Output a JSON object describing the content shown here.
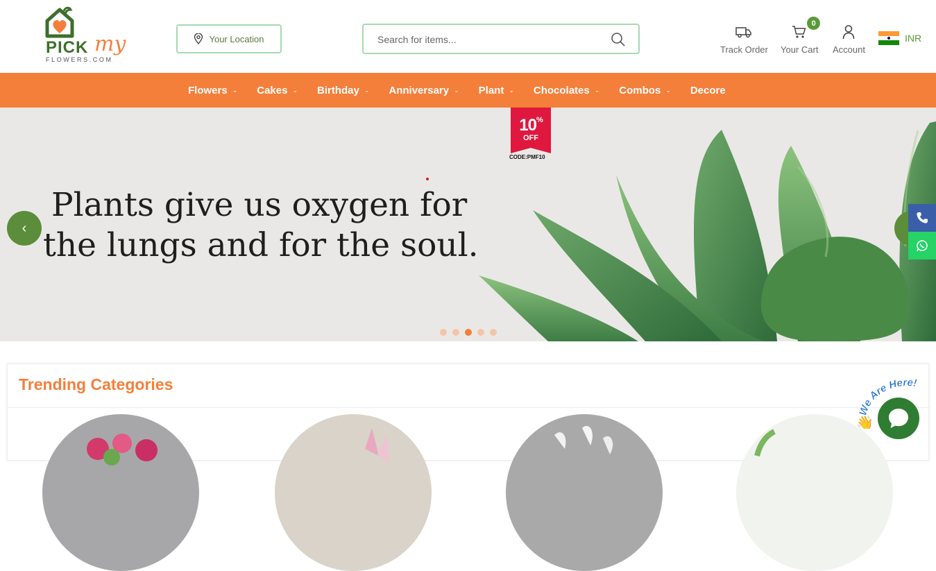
{
  "brand": {
    "logo_main": "PICK",
    "logo_accent": "my",
    "logo_sub": "FLOWERS.COM"
  },
  "header": {
    "location_label": "Your Location",
    "search_placeholder": "Search for items...",
    "track_order": "Track Order",
    "cart": "Your Cart",
    "cart_count": "0",
    "account": "Account",
    "currency": "INR"
  },
  "nav": {
    "items": [
      {
        "label": "Flowers",
        "dropdown": true
      },
      {
        "label": "Cakes",
        "dropdown": true
      },
      {
        "label": "Birthday",
        "dropdown": true
      },
      {
        "label": "Anniversary",
        "dropdown": true
      },
      {
        "label": "Plant",
        "dropdown": true
      },
      {
        "label": "Chocolates",
        "dropdown": true
      },
      {
        "label": "Combos",
        "dropdown": true
      },
      {
        "label": "Decore",
        "dropdown": false
      }
    ]
  },
  "banner": {
    "line1": "Plants give us oxygen for",
    "line2": "the lungs and for the soul.",
    "promo_percent": "10",
    "promo_percent_sign": "%",
    "promo_off": "OFF",
    "promo_code": "CODE:PMF10",
    "slide_count": 5,
    "active_slide": 3
  },
  "trending": {
    "title": "Trending Categories"
  },
  "chat": {
    "label": "We Are Here!"
  },
  "colors": {
    "accent_orange": "#f47f3a",
    "brand_green": "#5b8d3a",
    "call_blue": "#3b5ea8",
    "whatsapp_green": "#25d366"
  }
}
